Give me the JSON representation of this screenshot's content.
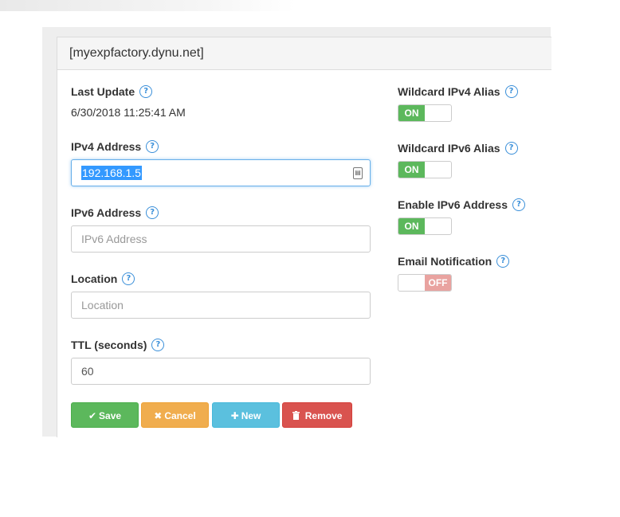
{
  "panel": {
    "title": "[myexpfactory.dynu.net]"
  },
  "help_symbol": "?",
  "fields": {
    "last_update": {
      "label": "Last Update",
      "value": "6/30/2018 11:25:41 AM"
    },
    "ipv4": {
      "label": "IPv4 Address",
      "value": "192.168.1.5"
    },
    "ipv6": {
      "label": "IPv6 Address",
      "placeholder": "IPv6 Address",
      "value": ""
    },
    "location": {
      "label": "Location",
      "placeholder": "Location",
      "value": ""
    },
    "ttl": {
      "label": "TTL (seconds)",
      "value": "60"
    }
  },
  "toggles": {
    "wildcard_ipv4": {
      "label": "Wildcard IPv4 Alias",
      "state": "ON"
    },
    "wildcard_ipv6": {
      "label": "Wildcard IPv6 Alias",
      "state": "ON"
    },
    "enable_ipv6": {
      "label": "Enable IPv6 Address",
      "state": "ON"
    },
    "email_notification": {
      "label": "Email Notification",
      "state": "OFF"
    }
  },
  "buttons": {
    "save": "Save",
    "cancel": "Cancel",
    "new": "New",
    "remove": "Remove"
  },
  "icons": {
    "help": "question-circle-icon",
    "save": "check-icon",
    "cancel": "times-icon",
    "new": "plus-icon",
    "remove": "trash-icon",
    "field_button": "id-card-icon"
  },
  "colors": {
    "success": "#5cb85c",
    "warning": "#f0ad4e",
    "info": "#5bc0de",
    "danger": "#d9534f",
    "off_toggle": "#e9a3a0",
    "help_icon": "#3a8fd9"
  }
}
